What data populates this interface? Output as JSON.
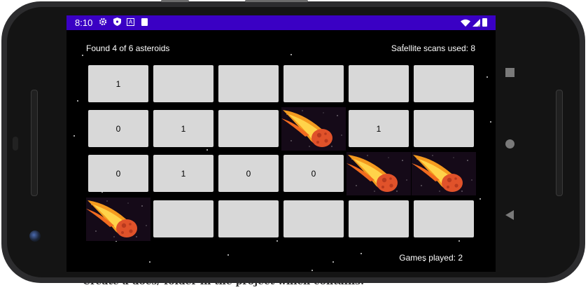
{
  "background_text": "Create a docs/ folder in the project which contains:",
  "statusbar": {
    "time": "8:10",
    "left_icons": [
      "gear-icon",
      "shield-icon",
      "a-icon",
      "sd-card-icon"
    ],
    "right_icons": [
      "wifi-icon",
      "signal-icon",
      "battery-icon"
    ],
    "bg_color": "#3a00c4"
  },
  "game": {
    "found_text": "Found 4 of 6 asteroids",
    "scans_text": "Satellite scans used: 8",
    "games_played_text": "Games played: 2",
    "grid": {
      "rows": 4,
      "cols": 6,
      "cells": [
        {
          "state": "revealed",
          "value": "1"
        },
        {
          "state": "hidden",
          "value": ""
        },
        {
          "state": "hidden",
          "value": ""
        },
        {
          "state": "hidden",
          "value": ""
        },
        {
          "state": "hidden",
          "value": ""
        },
        {
          "state": "hidden",
          "value": ""
        },
        {
          "state": "revealed",
          "value": "0"
        },
        {
          "state": "revealed",
          "value": "1"
        },
        {
          "state": "hidden",
          "value": ""
        },
        {
          "state": "asteroid",
          "value": ""
        },
        {
          "state": "revealed",
          "value": "1"
        },
        {
          "state": "hidden",
          "value": ""
        },
        {
          "state": "revealed",
          "value": "0"
        },
        {
          "state": "revealed",
          "value": "1"
        },
        {
          "state": "revealed",
          "value": "0"
        },
        {
          "state": "revealed",
          "value": "0"
        },
        {
          "state": "asteroid",
          "value": ""
        },
        {
          "state": "asteroid",
          "value": ""
        },
        {
          "state": "asteroid",
          "value": ""
        },
        {
          "state": "hidden",
          "value": ""
        },
        {
          "state": "hidden",
          "value": ""
        },
        {
          "state": "hidden",
          "value": ""
        },
        {
          "state": "hidden",
          "value": ""
        },
        {
          "state": "hidden",
          "value": ""
        }
      ]
    }
  },
  "nav_buttons": [
    "recents-square-icon",
    "home-circle-icon",
    "back-triangle-icon"
  ]
}
